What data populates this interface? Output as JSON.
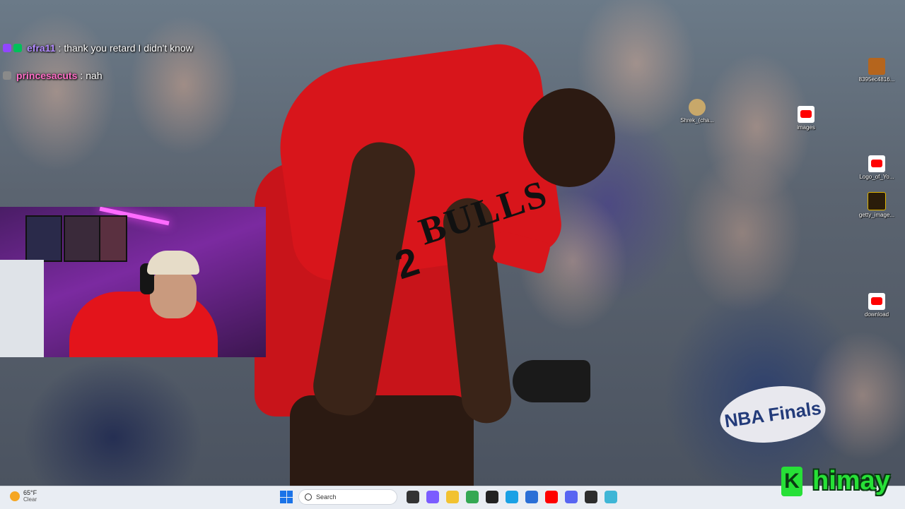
{
  "chat": {
    "messages": [
      {
        "user": "efra11",
        "text": "thank you retard I didn't know",
        "user_color": "#b38cff"
      },
      {
        "user": "princesacuts",
        "text": "nah",
        "user_color": "#ff6ec7"
      }
    ]
  },
  "wallpaper": {
    "jersey_text": "BULLS",
    "jersey_number": "2",
    "badge_text": "NBA Finals"
  },
  "desktop_icons": [
    {
      "label": "8395ec4816...",
      "icon": "photo-icon"
    },
    {
      "label": "Shrek_(cha...",
      "icon": "shrek-icon"
    },
    {
      "label": "images",
      "icon": "youtube-icon"
    },
    {
      "label": "Logo_of_Yo...",
      "icon": "youtube-icon"
    },
    {
      "label": "getty_image...",
      "icon": "getty-icon"
    },
    {
      "label": "download",
      "icon": "youtube-icon"
    }
  ],
  "taskbar": {
    "weather": {
      "temp": "65°F",
      "condition": "Clear"
    },
    "search_placeholder": "Search",
    "apps": [
      {
        "name": "task-view-icon",
        "color": "#333333"
      },
      {
        "name": "copilot-icon",
        "color": "#7b5cff"
      },
      {
        "name": "file-explorer-icon",
        "color": "#f2c230"
      },
      {
        "name": "chrome-icon",
        "color": "#34a853"
      },
      {
        "name": "obs-icon",
        "color": "#222222"
      },
      {
        "name": "edge-icon",
        "color": "#1aa1e5"
      },
      {
        "name": "store-icon",
        "color": "#2b6fd6"
      },
      {
        "name": "youtube-icon",
        "color": "#ff0000"
      },
      {
        "name": "discord-icon",
        "color": "#5865f2"
      },
      {
        "name": "terminal-icon",
        "color": "#2d2d2d"
      },
      {
        "name": "notepad-icon",
        "color": "#3fb6d6"
      }
    ]
  },
  "logo": {
    "text": "himay",
    "mark": "K"
  }
}
